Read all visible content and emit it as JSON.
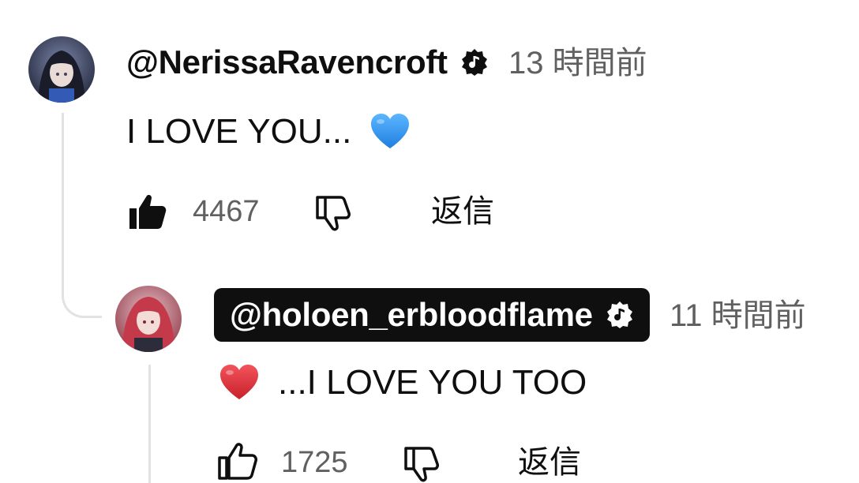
{
  "comment": {
    "handle": "@NerissaRavencroft",
    "time": "13 時間前",
    "text": "I LOVE YOU...",
    "emoji": "blue-heart",
    "likes": "4467",
    "reply_label": "返信",
    "liked": true
  },
  "reply": {
    "handle": "@holoen_erbloodflame",
    "time": "11 時間前",
    "text": "...I LOVE YOU TOO",
    "emoji": "red-heart",
    "likes": "1725",
    "reply_label": "返信",
    "liked": false,
    "handle_highlighted": true
  },
  "colors": {
    "text": "#0f0f0f",
    "secondary": "#606060",
    "thread_line": "#e2e2e2",
    "blue_heart": "#3d9df2",
    "red_heart": "#e0313a"
  }
}
